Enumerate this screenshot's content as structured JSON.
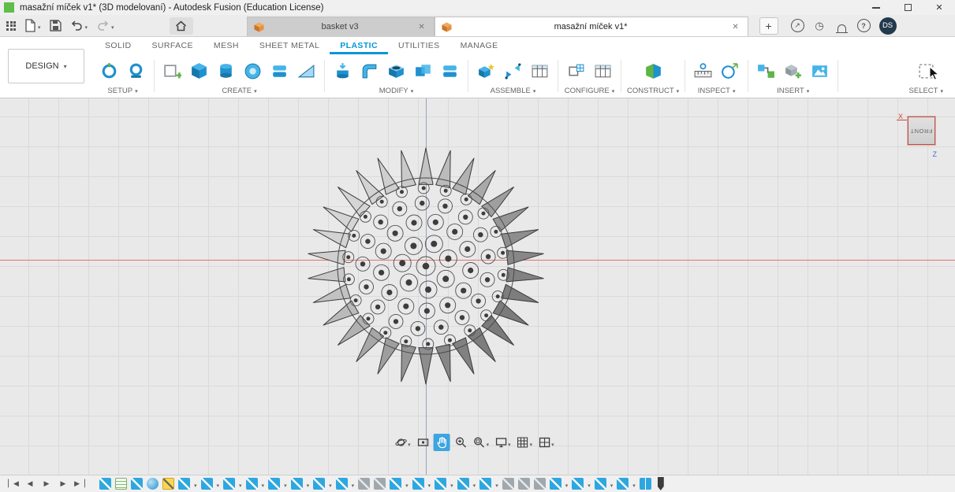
{
  "window": {
    "title": "masažní míček v1* (3D modelovaní) - Autodesk Fusion (Education License)"
  },
  "tab_bar": {
    "tabs": [
      {
        "label": "basket v3",
        "active": false
      },
      {
        "label": "masažní míček v1*",
        "active": true
      }
    ],
    "avatar_initials": "DS"
  },
  "ribbon": {
    "workspace": "DESIGN",
    "tabs": [
      {
        "label": "SOLID"
      },
      {
        "label": "SURFACE"
      },
      {
        "label": "MESH"
      },
      {
        "label": "SHEET METAL"
      },
      {
        "label": "PLASTIC",
        "active": true
      },
      {
        "label": "UTILITIES"
      },
      {
        "label": "MANAGE"
      }
    ],
    "groups": [
      {
        "label": "SETUP"
      },
      {
        "label": "CREATE"
      },
      {
        "label": "MODIFY"
      },
      {
        "label": "ASSEMBLE"
      },
      {
        "label": "CONFIGURE"
      },
      {
        "label": "CONSTRUCT"
      },
      {
        "label": "INSPECT"
      },
      {
        "label": "INSERT"
      },
      {
        "label": "SELECT"
      }
    ]
  },
  "canvas": {
    "viewcube": {
      "face": "FRONT",
      "x_label": "X",
      "z_label": "Z"
    },
    "ball": {
      "radius": 112,
      "spike_count": 30,
      "spike_len": 38,
      "rings": [
        [
          0,
          1,
          12
        ],
        [
          30,
          7,
          11
        ],
        [
          57,
          13,
          10
        ],
        [
          80,
          17,
          9
        ],
        [
          99,
          22,
          7
        ]
      ]
    }
  },
  "nav_bar": {
    "items": [
      "orbit",
      "look-at",
      "pan",
      "zoom",
      "zoom-window",
      "display-settings",
      "grid",
      "viewports"
    ],
    "selected": "pan"
  },
  "timeline": {
    "playback": [
      "go-to-start",
      "step-back",
      "play",
      "step-forward",
      "go-to-end"
    ],
    "items": [
      {
        "type": "sketch"
      },
      {
        "type": "doc"
      },
      {
        "type": "sketch"
      },
      {
        "type": "sphere"
      },
      {
        "type": "yellow"
      },
      {
        "type": "sketch",
        "caret": true
      },
      {
        "type": "sketch",
        "caret": true
      },
      {
        "type": "sketch",
        "caret": true
      },
      {
        "type": "sketch",
        "caret": true
      },
      {
        "type": "sketch",
        "caret": true
      },
      {
        "type": "sketch",
        "caret": true
      },
      {
        "type": "sketch",
        "caret": true
      },
      {
        "type": "sketch",
        "caret": true
      },
      {
        "type": "gray"
      },
      {
        "type": "gray"
      },
      {
        "type": "sketch",
        "caret": true
      },
      {
        "type": "sketch",
        "caret": true
      },
      {
        "type": "sketch",
        "caret": true
      },
      {
        "type": "sketch",
        "caret": true
      },
      {
        "type": "sketch",
        "caret": true
      },
      {
        "type": "gray"
      },
      {
        "type": "gray"
      },
      {
        "type": "gray"
      },
      {
        "type": "sketch",
        "caret": true
      },
      {
        "type": "sketch",
        "caret": true
      },
      {
        "type": "sketch",
        "caret": true
      },
      {
        "type": "sketch",
        "caret": true
      },
      {
        "type": "mirror"
      }
    ]
  },
  "colors": {
    "accent": "#0696d7",
    "icon_blue": "#1f91cf",
    "icon_blue_light": "#45b4e8",
    "highlight_yellow": "#ffd84d",
    "axis_red": "#e0756b",
    "axis_blue": "#97a2be",
    "app_green": "#5fbe4a"
  }
}
